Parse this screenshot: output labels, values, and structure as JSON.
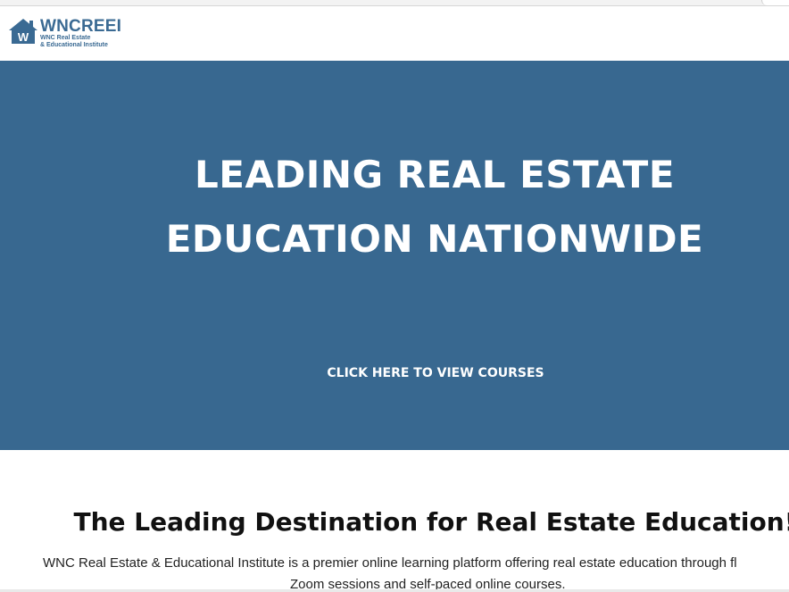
{
  "logo": {
    "name": "WNCREEI",
    "subtitle_line1": "WNC Real Estate",
    "subtitle_line2": "& Educational Institute",
    "mark_letter": "W",
    "icon": "house-icon"
  },
  "hero": {
    "title_line1": "LEADING REAL ESTATE",
    "title_line2": "EDUCATION NATIONWIDE",
    "cta_label": "CLICK HERE TO VIEW COURSES",
    "background_color": "#386890"
  },
  "intro": {
    "heading": "The Leading Destination for Real Estate Education!",
    "text_line1": "WNC Real Estate & Educational Institute is a premier online learning platform offering real estate education through fl",
    "text_line2": "Zoom sessions and self-paced online courses."
  },
  "colors": {
    "brand": "#3a6a93",
    "hero_bg": "#386890",
    "text": "#111111"
  }
}
